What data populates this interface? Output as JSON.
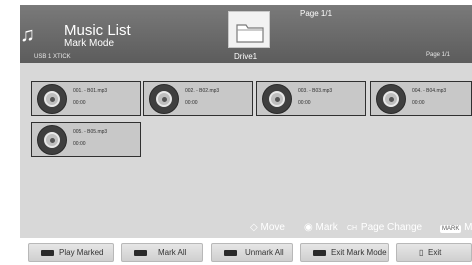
{
  "header": {
    "title": "Music List",
    "subtitle": "Mark Mode",
    "storage": "USB 1 XTICK",
    "page_indicator": "Page 1/1",
    "page_indicator_small": "Page 1/1",
    "folder_icon": "folder-icon",
    "drive": "Drive1"
  },
  "files": [
    {
      "name": "001. - B01.mp3",
      "time": "00:00"
    },
    {
      "name": "002. - B02.mp3",
      "time": "00:00"
    },
    {
      "name": "003. - B03.mp3",
      "time": "00:00"
    },
    {
      "name": "004. - B04.mp3",
      "time": "00:00"
    },
    {
      "name": "005. - B05.mp3",
      "time": "00:00"
    }
  ],
  "hints": {
    "move_icon": "◇",
    "move": "Move",
    "mark_icon": "◉",
    "mark": "Mark",
    "ch": "CH",
    "page_change": "Page Change",
    "mark_key": "MARK",
    "mark_key_label": "Ma"
  },
  "buttons": {
    "play_marked": "Play Marked",
    "mark_all": "Mark All",
    "unmark_all": "Unmark All",
    "exit_mark_mode": "Exit Mark Mode",
    "exit_icon": "▯",
    "exit": "Exit"
  },
  "colors": {
    "header_bg": "#6b6b6b",
    "content_bg": "#d8d8d8",
    "card_bg": "#c8c8c8",
    "card_border": "#303030",
    "button_bg": "#dedede"
  }
}
